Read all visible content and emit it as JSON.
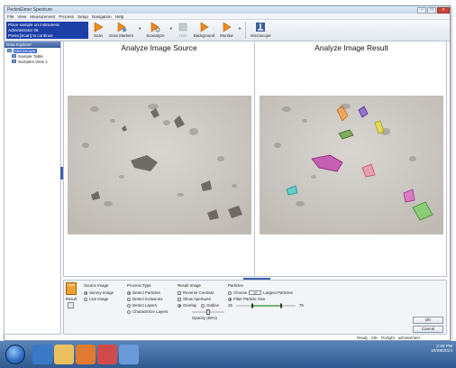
{
  "window": {
    "title": "PerkinElmer Spectrum"
  },
  "menu": [
    "File",
    "View",
    "Measurement",
    "Process",
    "Setup",
    "Navigation",
    "Help"
  ],
  "toolbar": {
    "status_lines": [
      "Place sample on instrument",
      "Administrator 06",
      "Press [Scan] to continue"
    ],
    "buttons": {
      "scan": "Scan",
      "scan_markers": "Scan Markers",
      "scanalyze": "Scanalyze",
      "halt": "Halt",
      "background": "Background",
      "monitor": "Monitor",
      "microscope": "Microscope"
    }
  },
  "sidebar": {
    "header": "Data Explorer",
    "items": [
      "Microscope",
      "Sample Table",
      "Samples View 1"
    ]
  },
  "panels": {
    "source_title": "Analyze Image Source",
    "result_title": "Analyze Image Result"
  },
  "settings": {
    "split_label": "Split",
    "result_label": "Result",
    "source_image": {
      "title": "Source Image",
      "options": [
        "Survey Image",
        "Live Image"
      ],
      "selected": "Survey Image"
    },
    "process_type": {
      "title": "Process Type",
      "options": [
        "Detect Particles",
        "Detect Inclusions",
        "Detect Layers",
        "Characterize Layers"
      ],
      "selected": "Detect Particles"
    },
    "result_image": {
      "title": "Result Image",
      "checks": [
        "Reverse Contrast",
        "Show Apertures"
      ],
      "modes": [
        "Overlay",
        "Outline"
      ],
      "selected_mode": "Overlay",
      "opacity_label": "Opacity (50%)",
      "opacity": 0.5
    },
    "particles": {
      "title": "Particles",
      "choose_label": "Choose",
      "choose_value": "10",
      "largest_label": "Largest Particles",
      "filter_label": "Filter Particle Size",
      "range_min": "25",
      "range_max": "75",
      "selected": "Filter Particle Size"
    },
    "ok": "OK",
    "cancel": "Cancel"
  },
  "statusbar": [
    "Ready",
    "Idle",
    "Firelight",
    "administrator"
  ],
  "taskbar": {
    "time": "3:40 PM",
    "date": "10/28/2014"
  },
  "colors": {
    "status_blue": "#1c3fa8",
    "accent": "#f0a030",
    "taskbar": "#2f5a91"
  }
}
